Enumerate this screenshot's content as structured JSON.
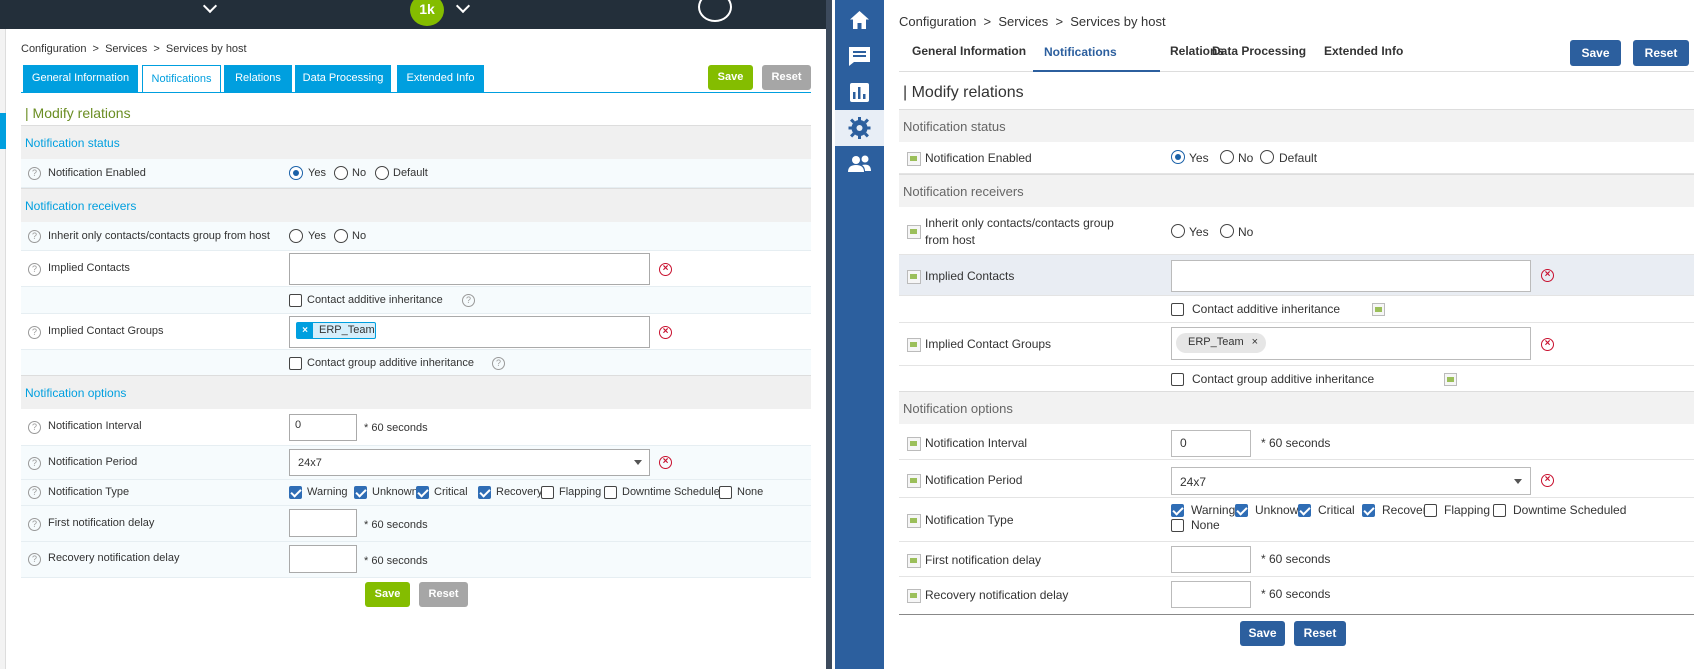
{
  "left": {
    "header": {
      "badge": "1k"
    },
    "breadcrumb": "Configuration  >  Services  >  Services by host",
    "tabs": [
      "General Information",
      "Notifications",
      "Relations",
      "Data Processing",
      "Extended Info"
    ],
    "save": "Save",
    "reset": "Reset",
    "modify_title": "| Modify relations",
    "sections": {
      "status": "Notification status",
      "receivers": "Notification receivers",
      "options": "Notification options"
    },
    "rows": {
      "enabled": "Notification Enabled",
      "inherit": "Inherit only contacts/contacts group from host",
      "contacts": "Implied Contacts",
      "contact_additive": "Contact additive inheritance",
      "groups": "Implied Contact Groups",
      "group_additive": "Contact group additive inheritance",
      "interval": "Notification Interval",
      "period": "Notification Period",
      "type": "Notification Type",
      "first_delay": "First notification delay",
      "recovery_delay": "Recovery notification delay"
    },
    "radios": {
      "yes": "Yes",
      "no": "No",
      "default": "Default"
    },
    "enabled_value": "Yes",
    "group_tag": "ERP_Team",
    "interval_value": "0",
    "seconds": "* 60 seconds",
    "period_value": "24x7",
    "types": [
      {
        "label": "Warning",
        "checked": true
      },
      {
        "label": "Unknown",
        "checked": true
      },
      {
        "label": "Critical",
        "checked": true
      },
      {
        "label": "Recovery",
        "checked": true
      },
      {
        "label": "Flapping",
        "checked": false
      },
      {
        "label": "Downtime Scheduled",
        "checked": false
      },
      {
        "label": "None",
        "checked": false
      }
    ],
    "accent": "#009fdf",
    "green": "#84bd00"
  },
  "right": {
    "sidebar_icons": [
      "home-icon",
      "monitoring-icon",
      "reporting-icon",
      "configuration-icon",
      "administration-icon"
    ],
    "breadcrumb": "Configuration  >  Services  >  Services by host",
    "tabs": [
      "General Information",
      "Notifications",
      "Relations",
      "Data Processing",
      "Extended Info"
    ],
    "save": "Save",
    "reset": "Reset",
    "modify_title": "| Modify relations",
    "sections": {
      "status": "Notification status",
      "receivers": "Notification receivers",
      "options": "Notification options"
    },
    "rows": {
      "enabled": "Notification Enabled",
      "inherit_1": "Inherit only contacts/contacts group",
      "inherit_2": "from host",
      "contacts": "Implied Contacts",
      "contact_additive": "Contact additive inheritance",
      "groups": "Implied Contact Groups",
      "group_additive": "Contact group additive inheritance",
      "interval": "Notification Interval",
      "period": "Notification Period",
      "type": "Notification Type",
      "first_delay": "First notification delay",
      "recovery_delay": "Recovery notification delay"
    },
    "radios": {
      "yes": "Yes",
      "no": "No",
      "default": "Default"
    },
    "group_tag": "ERP_Team",
    "tag_remove": "×",
    "interval_value": "0",
    "seconds": "* 60 seconds",
    "period_value": "24x7",
    "types": [
      {
        "label": "Warning",
        "checked": true
      },
      {
        "label": "Unknown",
        "checked": true
      },
      {
        "label": "Critical",
        "checked": true
      },
      {
        "label": "Recovery",
        "checked": true
      },
      {
        "label": "Flapping",
        "checked": false
      },
      {
        "label": "Downtime Scheduled",
        "checked": false
      },
      {
        "label": "None",
        "checked": false
      }
    ],
    "accent": "#2c5f9e"
  }
}
